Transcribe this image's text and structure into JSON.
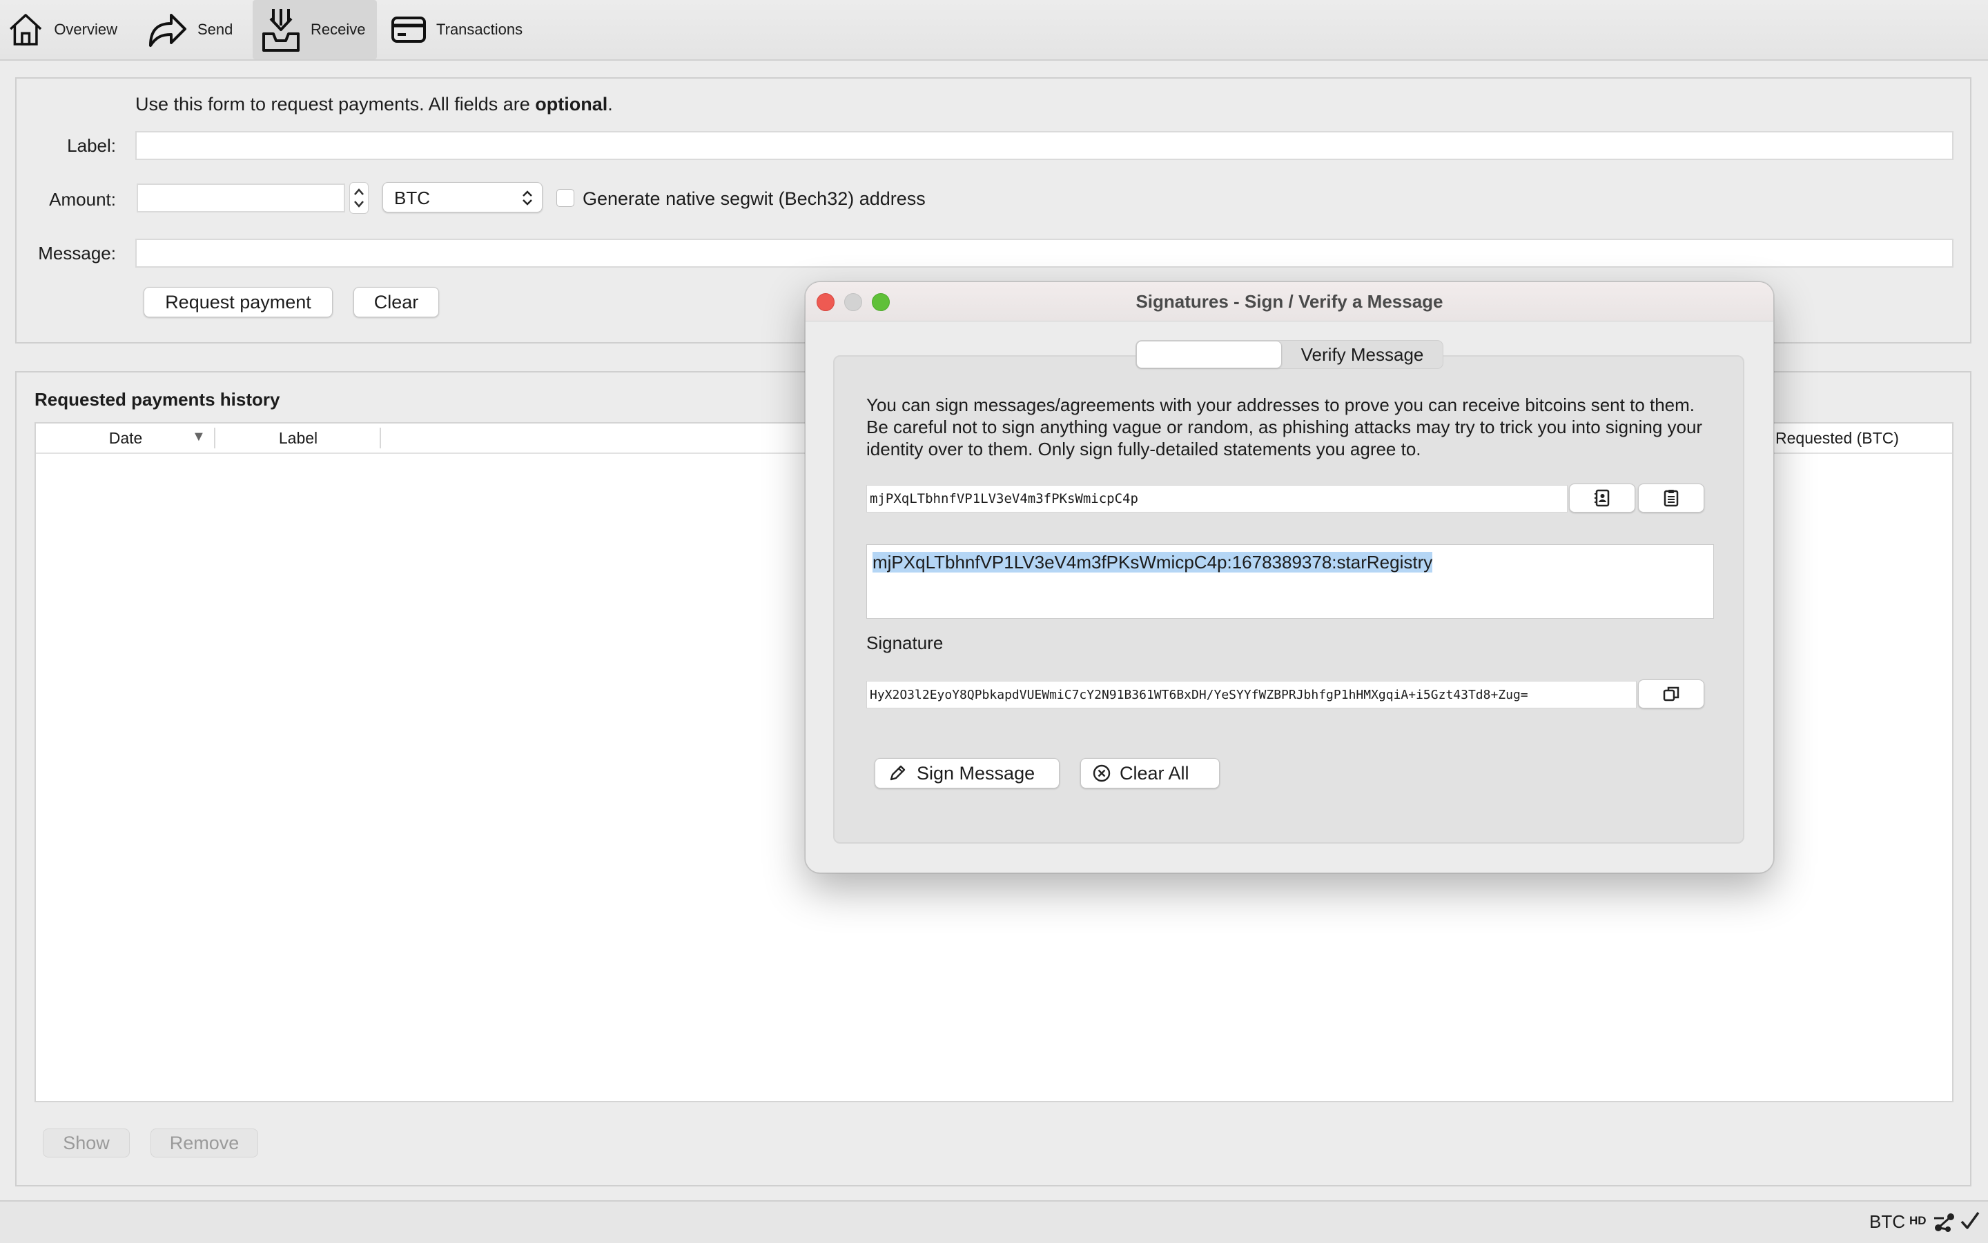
{
  "toolbar": {
    "tabs": [
      {
        "label": "Overview",
        "icon": "home-icon"
      },
      {
        "label": "Send",
        "icon": "send-arrow-icon"
      },
      {
        "label": "Receive",
        "icon": "receive-inbox-icon"
      },
      {
        "label": "Transactions",
        "icon": "card-icon"
      }
    ],
    "active_tab": "Receive"
  },
  "receive_form": {
    "intro_prefix": "Use this form to request payments. All fields are ",
    "intro_bold": "optional",
    "intro_suffix": ".",
    "label_label": "Label:",
    "label_value": "",
    "amount_label": "Amount:",
    "amount_value": "",
    "unit_selected": "BTC",
    "segwit_checkbox_label": "Generate native segwit (Bech32) address",
    "segwit_checked": false,
    "message_label": "Message:",
    "message_value": "",
    "request_button": "Request payment",
    "clear_button": "Clear"
  },
  "history": {
    "title": "Requested payments history",
    "columns": [
      "Date",
      "Label",
      "Requested (BTC)"
    ],
    "sort_indicator": "▼",
    "rows": [],
    "show_button": "Show",
    "remove_button": "Remove"
  },
  "statusbar": {
    "unit": "BTC",
    "hd_badge": "HD"
  },
  "dialog": {
    "title": "Signatures - Sign / Verify a Message",
    "tabs": {
      "sign": "",
      "verify": "Verify Message"
    },
    "description": "You can sign messages/agreements with your addresses to prove you can receive bitcoins sent to them. Be careful not to sign anything vague or random, as phishing attacks may try to trick you into signing your identity over to them. Only sign fully-detailed statements you agree to.",
    "address": "mjPXqLTbhnfVP1LV3eV4m3fPKsWmicpC4p",
    "message": "mjPXqLTbhnfVP1LV3eV4m3fPKsWmicpC4p:1678389378:starRegistry",
    "signature_label": "Signature",
    "signature": "HyX2O3l2EyoY8QPbkapdVUEWmiC7cY2N91B361WT6BxDH/YeSYYfWZBPRJbhfgP1hHMXgqiA+i5Gzt43Td8+Zug=",
    "sign_button": "Sign Message",
    "clear_all_button": "Clear All"
  },
  "colors": {
    "window_bg": "#ececec",
    "selection": "#b5d6f5",
    "close_light": "#ee5a52",
    "minimize_light": "#d3d3d3",
    "zoom_light": "#5fc038"
  }
}
